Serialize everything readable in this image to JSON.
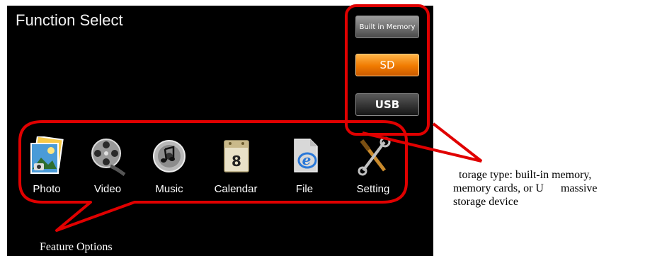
{
  "screen": {
    "title": "Function Select"
  },
  "storage": {
    "built_in_memory": "Built in Memory",
    "sd": "SD",
    "usb": "USB"
  },
  "features": [
    {
      "label": "Photo",
      "icon": "photo-icon"
    },
    {
      "label": "Video",
      "icon": "film-reel-icon"
    },
    {
      "label": "Music",
      "icon": "music-disc-icon"
    },
    {
      "label": "Calendar",
      "icon": "calendar-icon"
    },
    {
      "label": "File",
      "icon": "file-icon"
    },
    {
      "label": "Setting",
      "icon": "tools-icon"
    }
  ],
  "annotations": {
    "feature_options": "Feature Options",
    "storage_line1": "  torage type: built-in memory,",
    "storage_line2": "memory cards, or U      massive",
    "storage_line3": "storage device"
  },
  "colors": {
    "highlight_red": "#e00000",
    "sd_orange": "#f07a00",
    "screen_bg": "#000000"
  }
}
